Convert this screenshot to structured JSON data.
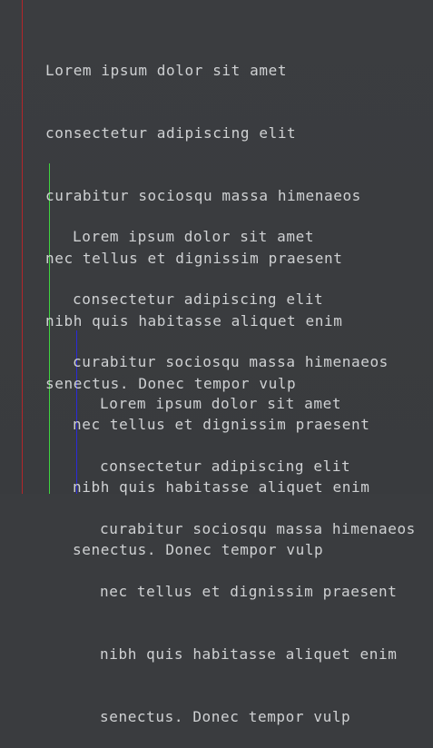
{
  "blocks": [
    {
      "lines": [
        "Lorem ipsum dolor sit amet",
        "consectetur adipiscing elit",
        "curabitur sociosqu massa himenaeos",
        "nec tellus et dignissim praesent",
        "nibh quis habitasse aliquet enim",
        "senectus. Donec tempor vulp"
      ]
    },
    {
      "lines": [
        "Lorem ipsum dolor sit amet",
        "consectetur adipiscing elit",
        "curabitur sociosqu massa himenaeos",
        "nec tellus et dignissim praesent",
        "nibh quis habitasse aliquet enim",
        "senectus. Donec tempor vulp"
      ]
    },
    {
      "lines": [
        "Lorem ipsum dolor sit amet",
        "consectetur adipiscing elit",
        "curabitur sociosqu massa himenaeos",
        "nec tellus et dignissim praesent",
        "nibh quis habitasse aliquet enim",
        "senectus. Donec tempor vulp"
      ]
    }
  ],
  "colors": {
    "background": "#3a3c3f",
    "text": "#cfd1d3",
    "guide_level_1": "#b3262a",
    "guide_level_2": "#3fd43f",
    "guide_level_3": "#2a2ad8"
  }
}
